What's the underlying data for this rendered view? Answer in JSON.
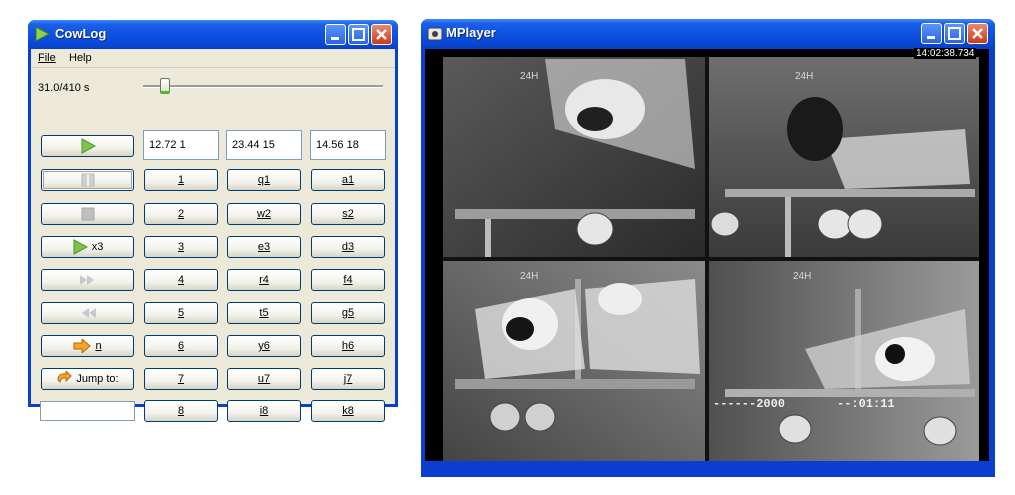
{
  "cowlog": {
    "title": "CowLog",
    "menu": [
      "File",
      "Help"
    ],
    "time_readout": "31.0/410 s",
    "slider_fraction": 0.076,
    "fields": [
      "12.72 1",
      "23.44 15",
      "14.56 18"
    ],
    "buttons": {
      "x3_label": "x3",
      "next_label": "n",
      "jump_label": "Jump to:",
      "jump_value": ""
    },
    "key_columns": [
      [
        "1",
        "2",
        "3",
        "4",
        "5",
        "6",
        "7",
        "8"
      ],
      [
        "q1",
        "w2",
        "e3",
        "r4",
        "t5",
        "y6",
        "u7",
        "i8"
      ],
      [
        "a1",
        "s2",
        "d3",
        "f4",
        "g5",
        "h6",
        "j7",
        "k8"
      ]
    ]
  },
  "mplayer": {
    "title": "MPlayer",
    "osd_time": "14:02:38.734",
    "overlay_left": "------2000",
    "overlay_right": "--:01:11",
    "cam_labels": [
      "24H",
      "24H",
      "24H",
      "24H"
    ]
  },
  "colors": {
    "xp_blue": "#0a47d6",
    "face": "#ece9d8",
    "play_green": "#7ec44a"
  }
}
